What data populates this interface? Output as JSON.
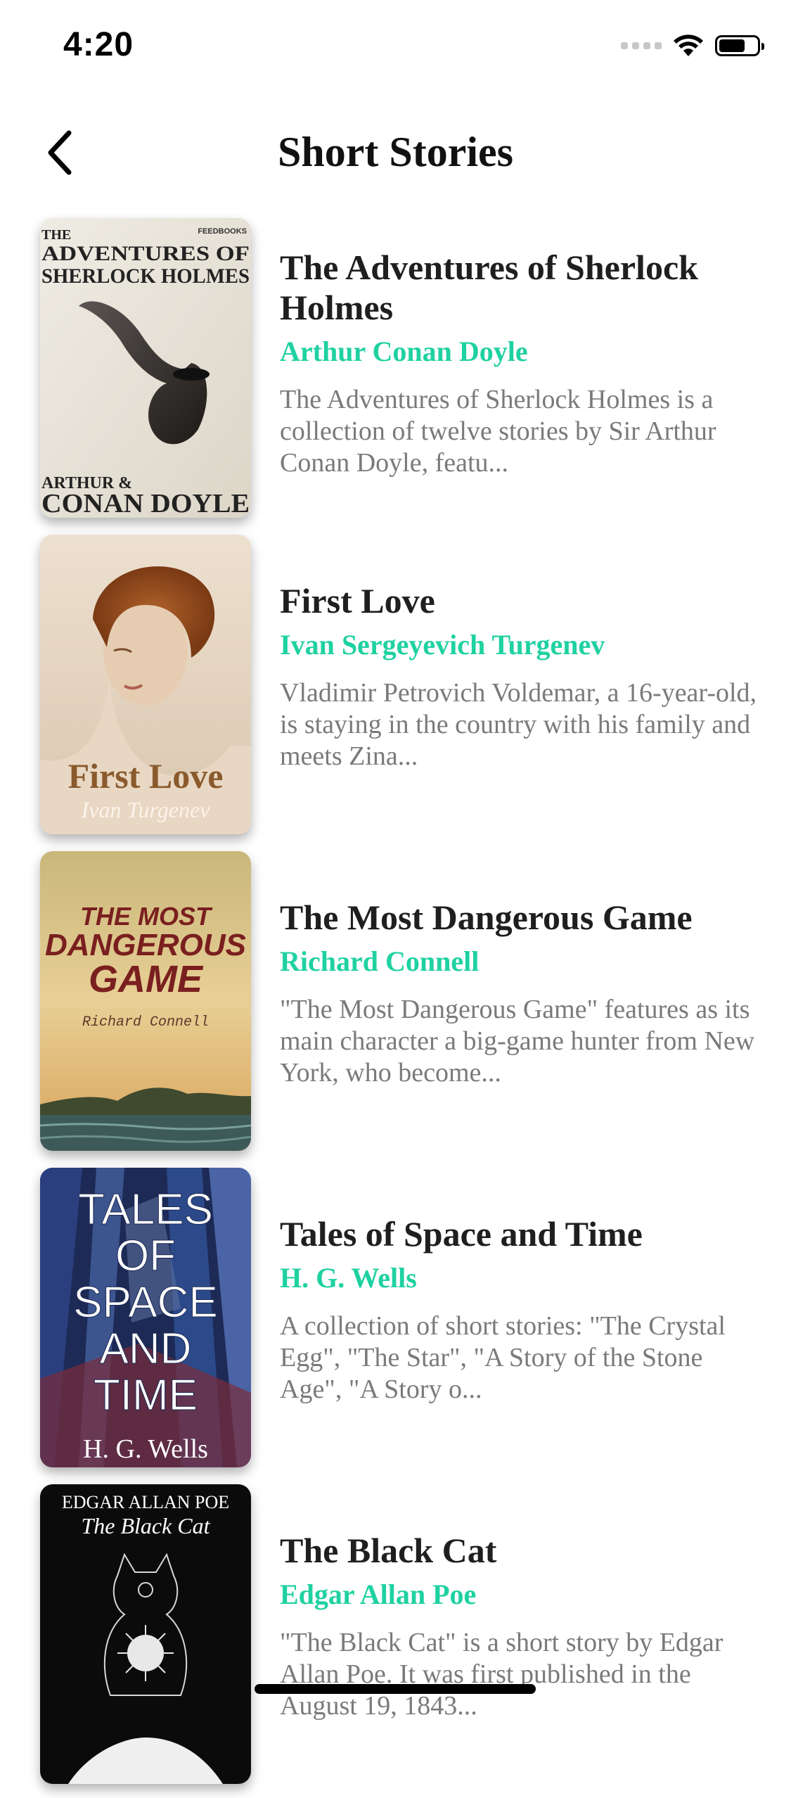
{
  "status_bar": {
    "time": "4:20"
  },
  "header": {
    "title": "Short Stories"
  },
  "books": [
    {
      "title": "The Adventures of Sherlock Holmes",
      "author": "Arthur Conan Doyle",
      "description": "The Adventures of Sherlock Holmes is a collection of twelve stories by Sir Arthur Conan Doyle, featu...",
      "cover": {
        "publisher": "FEEDBOOKS",
        "line1": "THE",
        "line2": "ADVENTURES OF",
        "line3": "SHERLOCK HOLMES",
        "author1": "ARTHUR &",
        "author2": "CONAN DOYLE"
      }
    },
    {
      "title": "First Love",
      "author": "Ivan Sergeyevich Turgenev",
      "description": "Vladimir Petrovich Voldemar, a 16-year-old, is staying in the country with his family and meets Zina...",
      "cover": {
        "title": "First Love",
        "author": "Ivan Turgenev"
      }
    },
    {
      "title": "The Most Dangerous Game",
      "author": "Richard Connell",
      "description": "\"The Most Dangerous Game\" features as its main character a big-game hunter from New York, who become...",
      "cover": {
        "line1": "THE MOST",
        "line2": "DANGEROUS",
        "line3": "GAME",
        "author": "Richard Connell"
      }
    },
    {
      "title": "Tales of Space and Time",
      "author": "H. G. Wells",
      "description": "A collection of short stories: \"The Crystal Egg\", \"The Star\", \"A Story of the Stone Age\", \"A Story o...",
      "cover": {
        "line1": "TALES",
        "line2": "OF",
        "line3": "SPACE",
        "line4": "AND",
        "line5": "TIME",
        "author": "H. G. Wells"
      }
    },
    {
      "title": "The Black Cat",
      "author": "Edgar Allan Poe",
      "description": "\"The Black Cat\" is a short story by Edgar Allan Poe. It was first published in the August 19, 1843...",
      "cover": {
        "author": "EDGAR ALLAN POE",
        "title": "The Black Cat"
      }
    }
  ]
}
